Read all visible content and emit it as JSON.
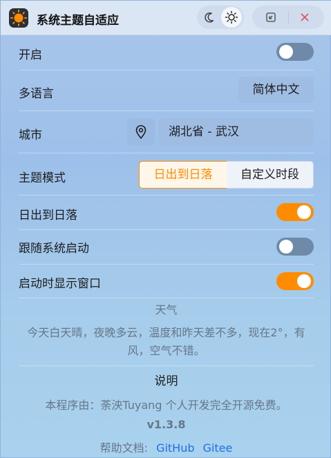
{
  "app": {
    "title": "系统主题自适应",
    "icon": "sun-logo-icon"
  },
  "titlebar": {
    "theme_buttons": [
      {
        "name": "moon-icon",
        "selected": false
      },
      {
        "name": "sun-icon",
        "selected": true
      }
    ],
    "window_buttons": [
      "restore-icon",
      "close-icon"
    ]
  },
  "settings": {
    "enable_label": "开启",
    "enable_on": false,
    "language_label": "多语言",
    "language_value": "简体中文",
    "city_label": "城市",
    "city_value": "湖北省 - 武汉",
    "theme_mode_label": "主题模式",
    "theme_mode_options": [
      "日出到日落",
      "自定义时段"
    ],
    "theme_mode_selected": 0,
    "sunrise_sunset_label": "日出到日落",
    "sunrise_sunset_on": true,
    "autostart_label": "跟随系统启动",
    "autostart_on": false,
    "show_window_label": "启动时显示窗口",
    "show_window_on": true
  },
  "weather": {
    "title": "天气",
    "text": "今天白天晴，夜晚多云，温度和昨天差不多，现在2°，有风，空气不错。"
  },
  "about": {
    "title": "说明",
    "text": "本程序由：荼泱Tuyang 个人开发完全开源免费。",
    "version": "v1.3.8",
    "help_label": "帮助文档:",
    "links": [
      "GitHub",
      "Gitee"
    ]
  },
  "colors": {
    "accent": "#ff8c00",
    "toggle_off": "#6f8aa8",
    "link": "#1e6fe8"
  }
}
